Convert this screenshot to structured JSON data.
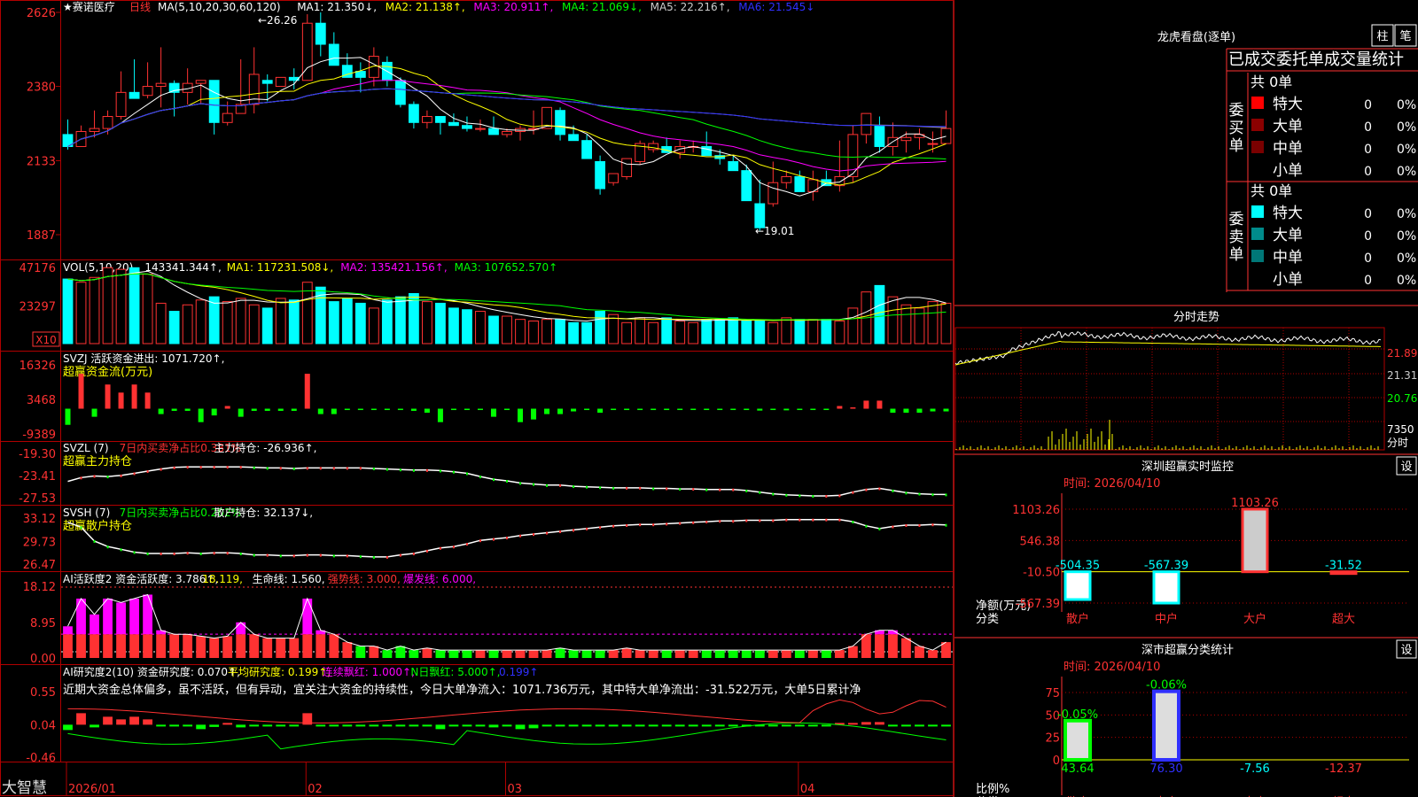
{
  "app": {
    "brand": "大智慧",
    "stock_name": "★赛诺医疗",
    "period_label": "日线"
  },
  "colors": {
    "up": "#ff3232",
    "down": "#00ffff",
    "grid": "#b00000",
    "yellow": "#ffff00",
    "green": "#00ff00",
    "magenta": "#ff00ff",
    "white": "#ffffff",
    "blue": "#3030ff",
    "gray": "#aaaaaa"
  },
  "main_panel": {
    "legend": [
      {
        "text": "MA(5,10,20,30,60,120)",
        "color": "#ffffff"
      },
      {
        "text": "MA1: 21.350↓,",
        "color": "#ffffff"
      },
      {
        "text": "MA2: 21.138↑,",
        "color": "#ffff00"
      },
      {
        "text": "MA3: 20.911↑,",
        "color": "#ff00ff"
      },
      {
        "text": "MA4: 21.069↓,",
        "color": "#00ff00"
      },
      {
        "text": "MA5: 22.216↑,",
        "color": "#cccccc"
      },
      {
        "text": "MA6: 21.545↓",
        "color": "#3030ff"
      }
    ],
    "axis_labels": [
      "2626",
      "2380",
      "2133",
      "1887"
    ],
    "high_label": "←26.26",
    "low_label": "←19.01"
  },
  "vol_panel": {
    "legend": [
      {
        "text": "VOL(5,10,20)",
        "color": "#ffffff"
      },
      {
        "text": "143341.344↑,",
        "color": "#ffffff"
      },
      {
        "text": "MA1: 117231.508↓,",
        "color": "#ffff00"
      },
      {
        "text": "MA2: 135421.156↑,",
        "color": "#ff00ff"
      },
      {
        "text": "MA3: 107652.570↑",
        "color": "#00ff00"
      }
    ],
    "axis_labels": [
      "47176",
      "23297"
    ],
    "unit_badge": "X10"
  },
  "svzj_panel": {
    "legend": [
      {
        "text": "SVZJ  活跃资金进出: 1071.720↑,",
        "color": "#ffffff"
      }
    ],
    "subtitle": "超赢资金流(万元)",
    "axis_labels": [
      "16326",
      "3468",
      "-9389"
    ]
  },
  "svzl_panel": {
    "legend": [
      {
        "text": "SVZL (7)",
        "color": "#ffffff"
      },
      {
        "text": "7日内买卖净占比0.381%",
        "color": "#ff3232"
      },
      {
        "text": "主力持仓: -26.936↑,",
        "color": "#ffffff"
      }
    ],
    "subtitle": "超赢主力持仓",
    "axis_labels": [
      "-19.30",
      "-23.41",
      "-27.53"
    ]
  },
  "svsh_panel": {
    "legend": [
      {
        "text": "SVSH (7)",
        "color": "#ffffff"
      },
      {
        "text": "7日内买卖净占比0.202%",
        "color": "#00ff00"
      },
      {
        "text": "散户持仓: 32.137↓,",
        "color": "#ffffff"
      }
    ],
    "subtitle": "超赢散户持仓",
    "axis_labels": [
      "33.12",
      "29.73",
      "26.47"
    ]
  },
  "ai_active_panel": {
    "legend": [
      {
        "text": "AI活跃度2 资金活跃度: 3.786↑,",
        "color": "#ffffff"
      },
      {
        "text": "18.119,",
        "color": "#ffff00"
      },
      {
        "text": "生命线: 1.560,",
        "color": "#ffffff"
      },
      {
        "text": "强势线: 3.000,",
        "color": "#ff3232"
      },
      {
        "text": "爆发线: 6.000,",
        "color": "#ff00ff"
      }
    ],
    "axis_labels": [
      "18.12",
      "8.95",
      "0.00"
    ]
  },
  "ai_research_panel": {
    "legend": [
      {
        "text": "AI研究度2(10) 资金研究度: 0.070↑,",
        "color": "#ffffff"
      },
      {
        "text": "平均研究度: 0.199↑,",
        "color": "#ffff00"
      },
      {
        "text": "连续飘红: 1.000↑,",
        "color": "#ff00ff"
      },
      {
        "text": "N日飘红: 5.000↑,",
        "color": "#00ff00"
      },
      {
        "text": "0.199↑",
        "color": "#3030ff"
      }
    ],
    "comment": "近期大资金总体偏多，虽不活跃，但有异动，宜关注大资金的持续性，今日大单净流入：1071.736万元，其中特大单净流出：-31.522万元，大单5日累计净",
    "axis_labels": [
      "0.55",
      "0.04",
      "-0.46"
    ]
  },
  "date_axis": [
    "2026/01",
    "02",
    "03",
    "04"
  ],
  "right": {
    "lhb": {
      "title": "龙虎看盘(逐单)",
      "btn_bar": "柱",
      "btn_order": "笔",
      "header": "已成交委托单成交量统计",
      "buy": {
        "side_label": "委买单",
        "total": "共 0单",
        "rows": [
          {
            "label": "特大",
            "count": "0",
            "pct": "0%",
            "color": "#ff0000"
          },
          {
            "label": "大单",
            "count": "0",
            "pct": "0%",
            "color": "#8b0000"
          },
          {
            "label": "中单",
            "count": "0",
            "pct": "0%",
            "color": "#7a0000"
          },
          {
            "label": "小单",
            "count": "0",
            "pct": "0%",
            "color": ""
          }
        ]
      },
      "sell": {
        "side_label": "委卖单",
        "total": "共 0单",
        "rows": [
          {
            "label": "特大",
            "count": "0",
            "pct": "0%",
            "color": "#00ffff"
          },
          {
            "label": "大单",
            "count": "0",
            "pct": "0%",
            "color": "#008b8b"
          },
          {
            "label": "中单",
            "count": "0",
            "pct": "0%",
            "color": "#007777"
          },
          {
            "label": "小单",
            "count": "0",
            "pct": "0%",
            "color": ""
          }
        ]
      }
    },
    "intraday": {
      "title": "分时走势",
      "price_labels": [
        "21.89",
        "21.31",
        "20.76"
      ],
      "vol_label": "7350",
      "vol_unit": "分时"
    },
    "monitor": {
      "title": "深圳超赢实时监控",
      "btn": "设",
      "time": "时间: 2026/04/10",
      "axis_labels": [
        "1103.26",
        "546.38",
        "-10.50",
        "-567.39"
      ],
      "y_title_1": "净额(万元)",
      "y_title_2": "分类",
      "categories": [
        "散户",
        "中户",
        "大户",
        "超大"
      ],
      "value_labels": [
        "-504.35",
        "-567.39",
        "1103.26",
        "-31.52"
      ]
    },
    "classify": {
      "title": "深市超赢分类统计",
      "btn": "设",
      "time": "时间: 2026/04/10",
      "axis_labels": [
        "75",
        "50",
        "25",
        "0"
      ],
      "y_title_1": "比例%",
      "y_title_2": "分类",
      "categories": [
        "散户",
        "中户",
        "大户",
        "超大"
      ],
      "top_labels": [
        "-0.05%",
        "-0.06%"
      ],
      "bottom_labels": [
        "43.64",
        "76.30",
        "-7.56",
        "-12.37"
      ]
    }
  },
  "chart_data": [
    {
      "type": "candlestick",
      "title": "赛诺医疗 日线",
      "x_range": [
        "2026/01",
        "2026/04/10"
      ],
      "ylim": [
        18.87,
        26.26
      ],
      "ticks": [
        26.26,
        23.8,
        21.33,
        18.87
      ],
      "ohlc": [
        [
          22.2,
          22.7,
          21.7,
          21.8
        ],
        [
          21.8,
          22.5,
          21.8,
          22.3
        ],
        [
          22.3,
          23.0,
          22.1,
          22.4
        ],
        [
          22.4,
          23.0,
          22.2,
          22.8
        ],
        [
          22.8,
          24.3,
          22.7,
          23.6
        ],
        [
          23.6,
          24.7,
          23.4,
          23.4
        ],
        [
          23.5,
          24.6,
          23.4,
          23.8
        ],
        [
          23.8,
          25.1,
          23.1,
          23.9
        ],
        [
          23.9,
          24.0,
          22.8,
          23.6
        ],
        [
          23.6,
          24.4,
          23.2,
          23.9
        ],
        [
          23.9,
          24.0,
          23.2,
          24.0
        ],
        [
          24.0,
          23.9,
          22.2,
          22.6
        ],
        [
          22.6,
          23.3,
          22.5,
          22.9
        ],
        [
          22.9,
          24.7,
          22.9,
          23.2
        ],
        [
          23.2,
          25.1,
          22.9,
          24.2
        ],
        [
          24.0,
          24.2,
          23.3,
          23.9
        ],
        [
          23.8,
          24.0,
          23.8,
          24.1
        ],
        [
          24.1,
          24.4,
          23.7,
          24.0
        ],
        [
          24.0,
          26.2,
          24.0,
          25.9
        ],
        [
          25.9,
          26.26,
          24.8,
          25.2
        ],
        [
          25.2,
          25.6,
          24.7,
          24.5
        ],
        [
          24.5,
          24.9,
          24.2,
          24.1
        ],
        [
          24.3,
          24.6,
          23.6,
          24.1
        ],
        [
          24.1,
          25.1,
          23.8,
          24.8
        ],
        [
          24.6,
          24.8,
          23.8,
          24.0
        ],
        [
          24.0,
          24.1,
          23.1,
          23.2
        ],
        [
          23.2,
          23.3,
          22.4,
          22.6
        ],
        [
          22.6,
          23.0,
          22.4,
          22.8
        ],
        [
          22.8,
          22.7,
          22.2,
          22.6
        ],
        [
          22.6,
          22.9,
          22.5,
          22.5
        ],
        [
          22.5,
          22.8,
          22.3,
          22.4
        ],
        [
          22.4,
          22.7,
          22.3,
          22.4
        ],
        [
          22.4,
          22.8,
          22.3,
          22.2
        ],
        [
          22.2,
          22.4,
          22.1,
          22.3
        ],
        [
          22.3,
          22.5,
          22.0,
          22.4
        ],
        [
          22.4,
          23.0,
          22.2,
          22.4
        ],
        [
          22.4,
          23.1,
          22.6,
          23.1
        ],
        [
          23.0,
          23.1,
          22.0,
          22.2
        ],
        [
          22.2,
          22.5,
          22.0,
          22.0
        ],
        [
          22.0,
          22.2,
          21.5,
          21.4
        ],
        [
          21.3,
          21.5,
          20.2,
          20.4
        ],
        [
          20.6,
          20.9,
          20.5,
          20.9
        ],
        [
          20.8,
          21.3,
          20.7,
          21.4
        ],
        [
          21.3,
          22.0,
          21.2,
          21.9
        ],
        [
          21.7,
          22.0,
          21.6,
          21.9
        ],
        [
          21.8,
          22.1,
          21.6,
          21.6
        ],
        [
          21.6,
          22.0,
          21.4,
          21.8
        ],
        [
          21.8,
          22.0,
          21.6,
          21.8
        ],
        [
          21.8,
          22.3,
          21.5,
          21.5
        ],
        [
          21.5,
          21.7,
          21.2,
          21.4
        ],
        [
          21.3,
          21.5,
          21.1,
          21.0
        ],
        [
          21.0,
          21.2,
          20.1,
          20.0
        ],
        [
          19.9,
          20.7,
          19.01,
          19.1
        ],
        [
          19.9,
          21.3,
          19.8,
          20.6
        ],
        [
          20.6,
          21.0,
          20.4,
          20.8
        ],
        [
          20.8,
          21.0,
          20.3,
          20.3
        ],
        [
          20.3,
          21.0,
          20.0,
          20.7
        ],
        [
          20.7,
          21.0,
          20.5,
          20.5
        ],
        [
          20.5,
          22.0,
          20.3,
          20.8
        ],
        [
          20.8,
          22.5,
          20.6,
          22.2
        ],
        [
          22.2,
          22.9,
          21.9,
          22.9
        ],
        [
          22.5,
          22.8,
          21.6,
          21.8
        ],
        [
          21.8,
          22.6,
          21.5,
          22.1
        ],
        [
          22.0,
          22.3,
          21.6,
          22.1
        ],
        [
          22.1,
          22.4,
          21.7,
          22.2
        ],
        [
          21.9,
          22.3,
          21.6,
          21.9
        ],
        [
          21.9,
          23.0,
          21.9,
          22.4
        ]
      ],
      "series": [
        {
          "name": "MA1",
          "values": [
            21.35
          ]
        },
        {
          "name": "MA2",
          "values": [
            21.138
          ]
        },
        {
          "name": "MA3",
          "values": [
            20.911
          ]
        },
        {
          "name": "MA4",
          "values": [
            21.069
          ]
        },
        {
          "name": "MA5",
          "values": [
            22.216
          ]
        },
        {
          "name": "MA6",
          "values": [
            21.545
          ]
        }
      ]
    },
    {
      "type": "bar",
      "title": "VOL(5,10,20)",
      "ylim": [
        0,
        47176
      ],
      "ticks": [
        47176,
        23297
      ],
      "values": [
        40000,
        38000,
        41000,
        47000,
        46000,
        47000,
        43000,
        25000,
        20000,
        24000,
        27000,
        29000,
        26000,
        28000,
        24000,
        22000,
        28000,
        27000,
        38000,
        35000,
        26000,
        28000,
        25000,
        22000,
        27000,
        29000,
        31000,
        26000,
        25000,
        22000,
        21000,
        20000,
        17000,
        17000,
        15000,
        14000,
        15000,
        15000,
        13000,
        13000,
        20000,
        18000,
        13000,
        16000,
        13000,
        16000,
        14000,
        13000,
        15000,
        15000,
        16000,
        14000,
        14000,
        13000,
        16000,
        15000,
        15000,
        15000,
        14000,
        22000,
        32000,
        36000,
        29000,
        24000,
        22000,
        26000,
        25000
      ]
    },
    {
      "type": "bar",
      "title": "SVZJ 活跃资金进出",
      "ylim": [
        -9389,
        16326
      ],
      "ticks": [
        16326,
        3468,
        -9389
      ],
      "values": [
        -6000,
        13000,
        -3000,
        9000,
        6000,
        9000,
        6000,
        -2000,
        -800,
        -800,
        -5000,
        -2500,
        1000,
        -3000,
        -800,
        -800,
        -800,
        -800,
        13000,
        -2000,
        -2000,
        -500,
        -500,
        -500,
        -500,
        -500,
        -800,
        -1500,
        -5000,
        -500,
        -300,
        -300,
        -3000,
        -400,
        -5000,
        -4000,
        -2000,
        -2000,
        -1000,
        -500,
        -1500,
        -500,
        -500,
        -500,
        -500,
        -500,
        -300,
        -300,
        -300,
        -300,
        -300,
        -500,
        -700,
        -400,
        -600,
        -400,
        -400,
        -400,
        1000,
        500,
        3000,
        3000,
        -1500,
        -1500,
        -1500,
        -1000,
        -1000
      ]
    },
    {
      "type": "line",
      "title": "SVZL 主力持仓",
      "ylim": [
        -27.53,
        -19.3
      ],
      "ticks": [
        -19.3,
        -23.41,
        -27.53
      ],
      "values": [
        -24.5,
        -23.8,
        -23.5,
        -23.6,
        -23.4,
        -23.0,
        -22.6,
        -22.2,
        -21.9,
        -21.8,
        -21.8,
        -21.8,
        -21.8,
        -21.8,
        -21.9,
        -22.0,
        -22.0,
        -22.1,
        -22.0,
        -22.0,
        -22.0,
        -22.0,
        -22.0,
        -22.1,
        -22.2,
        -22.3,
        -22.4,
        -22.4,
        -22.5,
        -22.7,
        -23.0,
        -23.6,
        -24.1,
        -24.4,
        -24.8,
        -25.0,
        -25.2,
        -25.2,
        -25.4,
        -25.5,
        -25.6,
        -25.7,
        -25.7,
        -25.7,
        -25.8,
        -25.8,
        -25.9,
        -25.9,
        -26.0,
        -26.0,
        -26.0,
        -26.2,
        -26.5,
        -26.8,
        -27.0,
        -27.1,
        -27.2,
        -27.2,
        -27.1,
        -26.5,
        -26.0,
        -25.8,
        -26.2,
        -26.6,
        -26.8,
        -26.9,
        -26.936
      ]
    },
    {
      "type": "line",
      "title": "SVSH 散户持仓",
      "ylim": [
        26.47,
        33.12
      ],
      "ticks": [
        33.12,
        29.73,
        26.47
      ],
      "values": [
        32.5,
        31.8,
        29.8,
        29.0,
        28.6,
        28.2,
        28.0,
        28.0,
        28.0,
        28.1,
        28.0,
        28.1,
        28.1,
        28.0,
        27.8,
        27.8,
        27.7,
        27.7,
        27.8,
        27.8,
        27.7,
        27.7,
        27.6,
        27.5,
        27.5,
        27.8,
        28.0,
        28.4,
        28.8,
        29.0,
        29.4,
        29.9,
        30.1,
        30.3,
        30.6,
        30.8,
        31.0,
        31.2,
        31.4,
        31.6,
        31.8,
        32.0,
        32.1,
        32.2,
        32.2,
        32.3,
        32.4,
        32.5,
        32.6,
        32.7,
        32.7,
        32.8,
        32.8,
        32.8,
        32.9,
        32.9,
        32.9,
        32.9,
        32.9,
        32.6,
        32.0,
        31.6,
        31.9,
        32.1,
        32.1,
        32.2,
        32.137
      ]
    },
    {
      "type": "bar",
      "title": "AI活跃度2 资金活跃度",
      "ylim": [
        0,
        18.12
      ],
      "ticks": [
        18.12,
        8.95,
        0.0
      ],
      "values": [
        8,
        15,
        11,
        15,
        14,
        15,
        16,
        7,
        6,
        6,
        5.5,
        5,
        5.5,
        9,
        6,
        5,
        5,
        5,
        15,
        7,
        6,
        4,
        3,
        3,
        2,
        3,
        2,
        2.5,
        2,
        2,
        2,
        2,
        2,
        2,
        2,
        2,
        2,
        2.5,
        2,
        2,
        2,
        2,
        2.5,
        2,
        2,
        2,
        2,
        2,
        2,
        2,
        2,
        2,
        2,
        2,
        2,
        2,
        2,
        2,
        2,
        3,
        6,
        7,
        7,
        5,
        3,
        2,
        4
      ]
    }
  ]
}
